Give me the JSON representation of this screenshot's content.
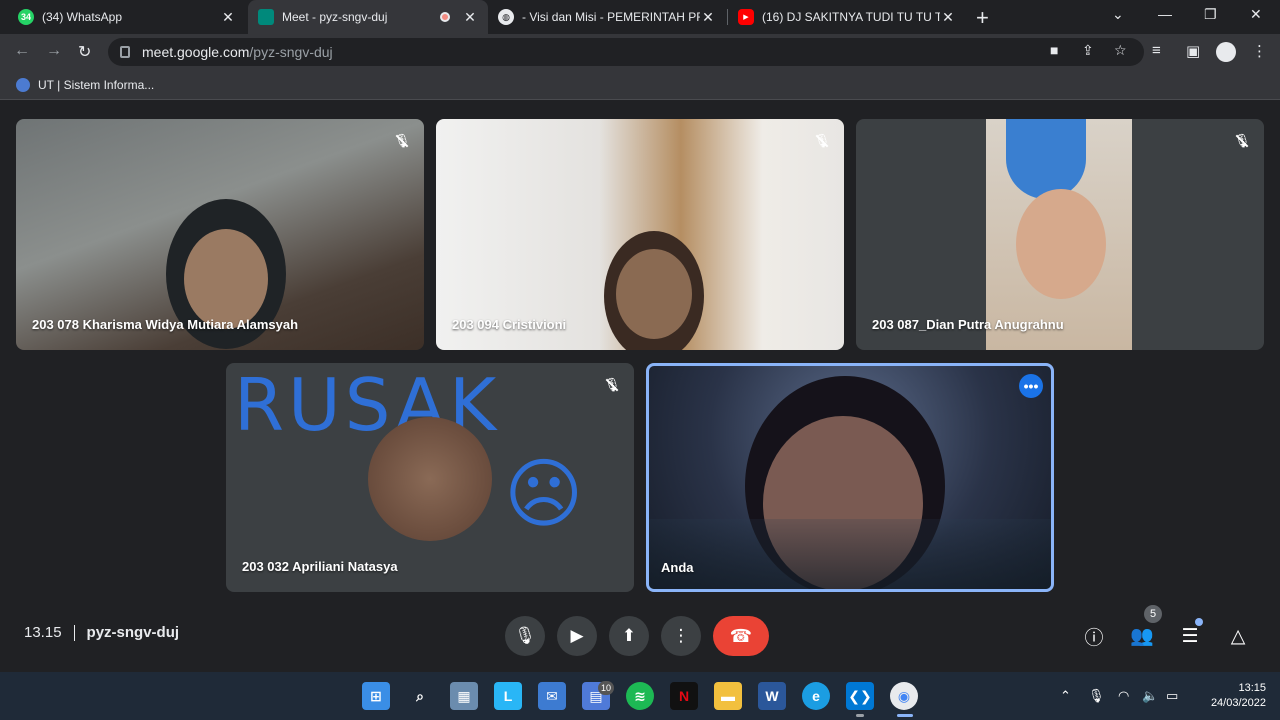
{
  "browser": {
    "tabs": [
      {
        "title": "(34) WhatsApp",
        "icon": "whatsapp-icon",
        "favicon_text": "34",
        "color": "#25d366",
        "active": false
      },
      {
        "title": "Meet - pyz-sngv-duj",
        "icon": "meet-icon",
        "favicon_text": "",
        "color": "#00897b",
        "active": true
      },
      {
        "title": "- Visi dan Misi - PEMERINTAH PR",
        "icon": "globe-icon",
        "favicon_text": "",
        "color": "#e8eaed",
        "active": false
      },
      {
        "title": "(16) DJ SAKITNYA TUDI TU TU TU",
        "icon": "youtube-icon",
        "favicon_text": "",
        "color": "#ff0000",
        "active": false
      }
    ],
    "url_host": "meet.google.com",
    "url_path": "/pyz-sngv-duj",
    "bookmark": "UT | Sistem Informa..."
  },
  "participants": [
    {
      "name": "203 078 Kharisma Widya Mutiara Alamsyah",
      "muted": true
    },
    {
      "name": "203 094 Cristivioni",
      "muted": true
    },
    {
      "name": "203 087_Dian Putra Anugrahnu",
      "muted": true
    },
    {
      "name": "203 032 Apriliani Natasya",
      "muted": true,
      "drawn_text": "RUSAK",
      "drawn_face": "☹"
    },
    {
      "name": "Anda",
      "muted": false,
      "pinned": true
    }
  ],
  "meeting": {
    "time": "13.15",
    "code": "pyz-sngv-duj",
    "participant_count": "5"
  },
  "taskbar": {
    "mail_badge": "10",
    "clock_time": "13:15",
    "clock_date": "24/03/2022"
  },
  "colors": {
    "hangup": "#ea4335",
    "accent": "#8ab4f8"
  }
}
